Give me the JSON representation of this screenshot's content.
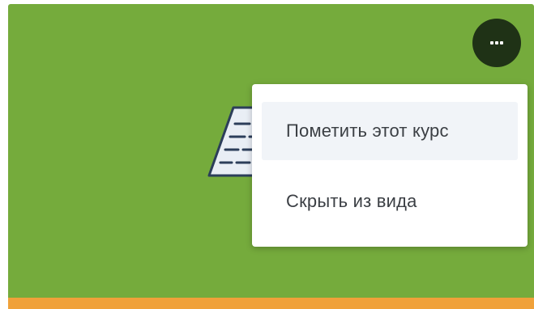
{
  "card": {
    "background_color": "#75ab3c",
    "bottom_bar_color": "#f0a13a"
  },
  "more_button": {
    "icon": "more-horizontal-icon",
    "background_color": "#1f3216"
  },
  "menu": {
    "items": [
      {
        "label": "Пометить этот курс",
        "highlighted": true
      },
      {
        "label": "Скрыть из вида",
        "highlighted": false
      }
    ]
  },
  "illustration": {
    "icon": "course-document-icon"
  }
}
